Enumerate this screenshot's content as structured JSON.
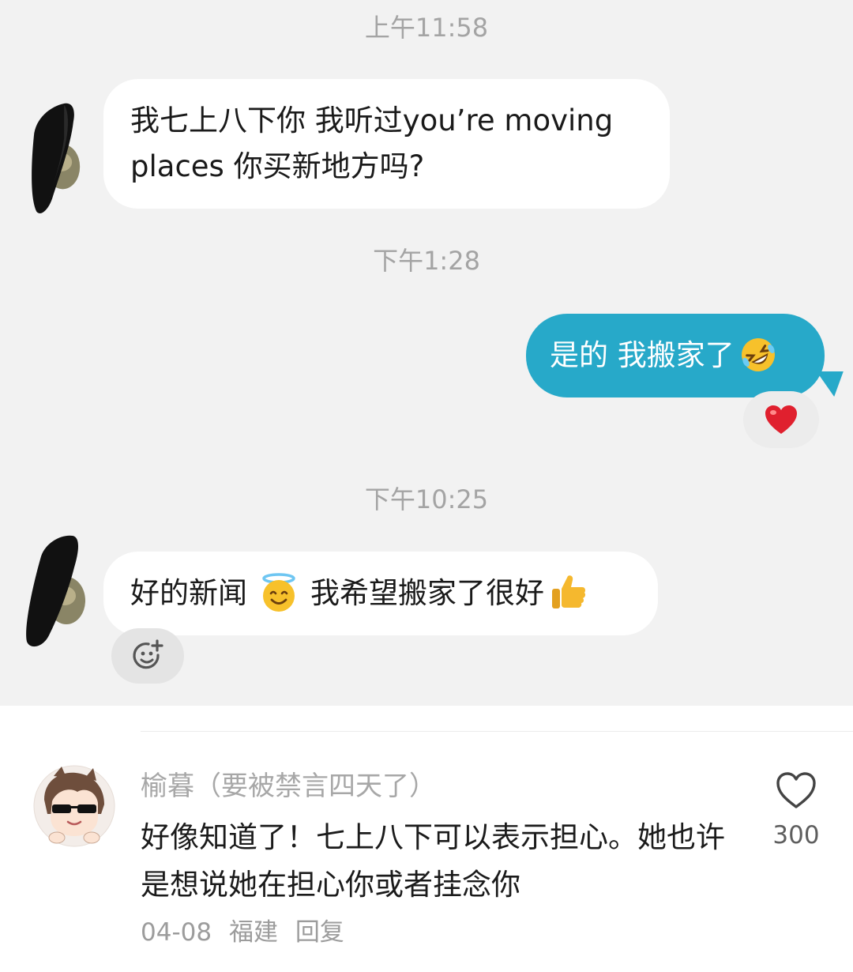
{
  "chat": {
    "timestamps": [
      "上午11:58",
      "下午1:28",
      "下午10:25"
    ],
    "messages": [
      {
        "direction": "incoming",
        "lines": [
          "我七上八下你 我听过you’re moving",
          "places 你买新地方吗?"
        ]
      },
      {
        "direction": "outgoing",
        "text": "是的 我搬家了",
        "emoji": "rolling-on-floor-laughing-emoji",
        "reaction": "heart-reaction-icon"
      },
      {
        "direction": "incoming",
        "text_before": "好的新闻",
        "emoji_1": "smiling-face-with-halo-emoji",
        "text_after": "我希望搬家了很好",
        "emoji_2": "thumbs-up-emoji",
        "reaction": "add-reaction-icon"
      }
    ],
    "colors": {
      "background": "#f2f2f2",
      "incoming_bubble": "#ffffff",
      "outgoing_bubble": "#27a9c9",
      "heart": "#e0202e"
    }
  },
  "comment": {
    "author": "榆暮（要被禁言四天了）",
    "text": "好像知道了！七上八下可以表示担心。她也许是想说她在担心你或者挂念你",
    "date": "04-08",
    "location": "福建",
    "reply_label": "回复",
    "like_count": "300"
  }
}
